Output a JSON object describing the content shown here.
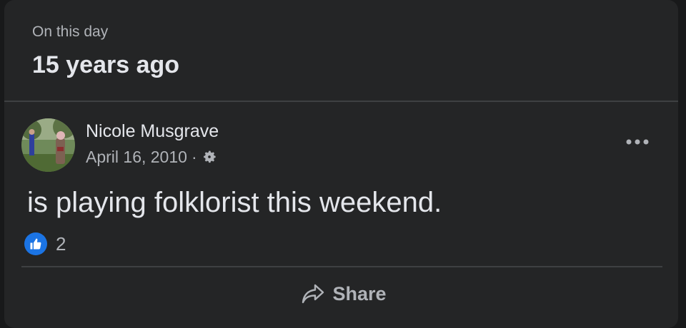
{
  "memory": {
    "eyebrow": "On this day",
    "title": "15 years ago"
  },
  "post": {
    "author": "Nicole Musgrave",
    "date": "April 16, 2010",
    "separator": "·",
    "privacy_icon": "gear-icon",
    "text": "is playing folklorist this weekend.",
    "reactions": {
      "icon": "thumbs-up-icon",
      "count": "2"
    },
    "more_icon": "more-options-icon"
  },
  "actions": {
    "share_label": "Share",
    "share_icon": "share-arrow-icon"
  },
  "colors": {
    "card_bg": "#242526",
    "primary_text": "#e4e6eb",
    "secondary_text": "#b0b3b8",
    "divider": "#3e4042",
    "like_blue": "#1b74e4"
  }
}
